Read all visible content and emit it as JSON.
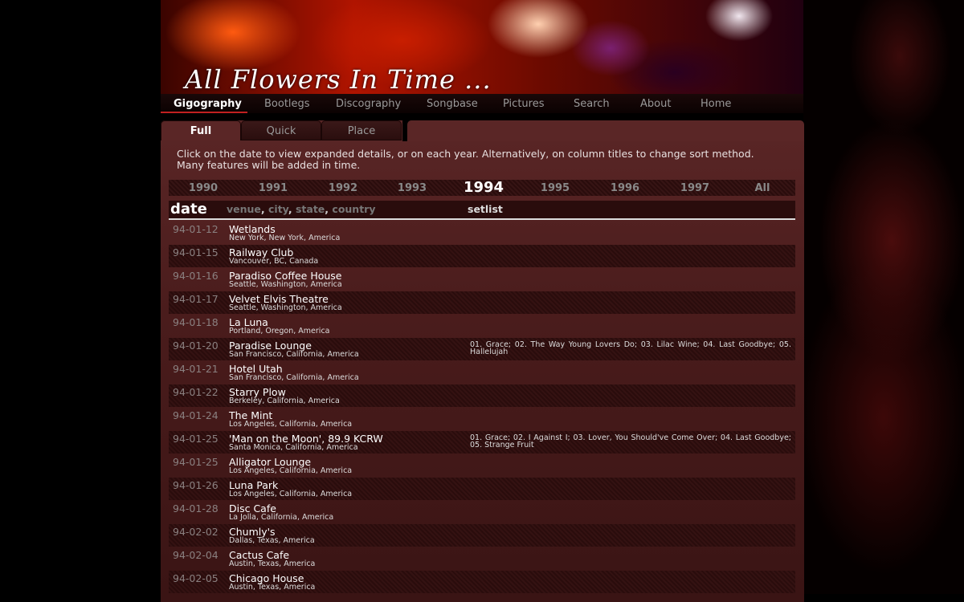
{
  "banner": {
    "logo": "All Flowers In Time ..."
  },
  "nav": {
    "items": [
      "Gigography",
      "Bootlegs",
      "Discography",
      "Songbase",
      "Pictures",
      "Search",
      "About",
      "Home"
    ]
  },
  "subtabs": [
    "Full",
    "Quick",
    "Place"
  ],
  "intro": {
    "line1": "Click on the date to view expanded details, or on each year. Alternatively, on column titles to change sort method.",
    "line2": "Many features will be added in time."
  },
  "years": [
    "1990",
    "1991",
    "1992",
    "1993",
    "1994",
    "1995",
    "1996",
    "1997",
    "All"
  ],
  "columns": {
    "date": "date",
    "venue": "venue",
    "city": "city",
    "state": "state",
    "country": "country",
    "setlist": "setlist"
  },
  "gigs": [
    {
      "date": "94-01-12",
      "venue": "Wetlands",
      "place": "New York, New York, America",
      "setlist": ""
    },
    {
      "date": "94-01-15",
      "venue": "Railway Club",
      "place": "Vancouver, BC, Canada",
      "setlist": ""
    },
    {
      "date": "94-01-16",
      "venue": "Paradiso Coffee House",
      "place": "Seattle, Washington, America",
      "setlist": ""
    },
    {
      "date": "94-01-17",
      "venue": "Velvet Elvis Theatre",
      "place": "Seattle, Washington, America",
      "setlist": ""
    },
    {
      "date": "94-01-18",
      "venue": "La Luna",
      "place": "Portland, Oregon, America",
      "setlist": ""
    },
    {
      "date": "94-01-20",
      "venue": "Paradise Lounge",
      "place": "San Francisco, California, America",
      "setlist": "01. Grace; 02. The Way Young Lovers Do; 03. Lilac Wine; 04. Last Goodbye; 05. Hallelujah"
    },
    {
      "date": "94-01-21",
      "venue": "Hotel Utah",
      "place": "San Francisco, California, America",
      "setlist": ""
    },
    {
      "date": "94-01-22",
      "venue": "Starry Plow",
      "place": "Berkeley, California, America",
      "setlist": ""
    },
    {
      "date": "94-01-24",
      "venue": "The Mint",
      "place": "Los Angeles, California, America",
      "setlist": ""
    },
    {
      "date": "94-01-25",
      "venue": "'Man on the Moon', 89.9 KCRW",
      "place": "Santa Monica, California, America",
      "setlist": "01. Grace; 02. I Against I; 03. Lover, You Should've Come Over; 04. Last Goodbye; 05. Strange Fruit"
    },
    {
      "date": "94-01-25",
      "venue": "Alligator Lounge",
      "place": "Los Angeles, California, America",
      "setlist": ""
    },
    {
      "date": "94-01-26",
      "venue": "Luna Park",
      "place": "Los Angeles, California, America",
      "setlist": ""
    },
    {
      "date": "94-01-28",
      "venue": "Disc Cafe",
      "place": "La Jolla, California, America",
      "setlist": ""
    },
    {
      "date": "94-02-02",
      "venue": "Chumly's",
      "place": "Dallas, Texas, America",
      "setlist": ""
    },
    {
      "date": "94-02-04",
      "venue": "Cactus Cafe",
      "place": "Austin, Texas, America",
      "setlist": ""
    },
    {
      "date": "94-02-05",
      "venue": "Chicago House",
      "place": "Austin, Texas, America",
      "setlist": ""
    }
  ],
  "colors": {
    "accent": "#c02020",
    "panel": "#5a2626"
  }
}
